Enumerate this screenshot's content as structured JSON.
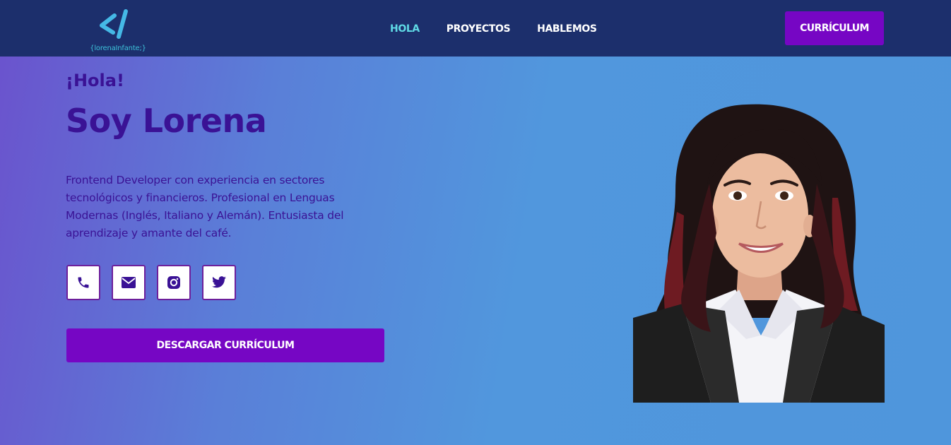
{
  "header": {
    "logo_text": "{lorenaInfante;}",
    "nav": [
      {
        "label": "HOLA",
        "active": true
      },
      {
        "label": "PROYECTOS",
        "active": false
      },
      {
        "label": "HABLEMOS",
        "active": false
      }
    ],
    "cv_button": "CURRÍCULUM"
  },
  "hero": {
    "greeting": "¡Hola!",
    "name": "Soy Lorena",
    "bio": "Frontend Developer con experiencia en sectores tecnológicos y financieros. Profesional en Lenguas Modernas (Inglés, Italiano y Alemán). Entusiasta del aprendizaje y amante del café.",
    "socials": [
      {
        "icon": "phone-icon"
      },
      {
        "icon": "mail-icon"
      },
      {
        "icon": "instagram-icon"
      },
      {
        "icon": "twitter-icon"
      }
    ],
    "download_button": "DESCARGAR CURRÍCULUM"
  },
  "colors": {
    "navbar": "#1c2f6c",
    "accent_purple": "#7606c4",
    "text_indigo": "#3a1295",
    "active_nav": "#5fd9e5"
  }
}
